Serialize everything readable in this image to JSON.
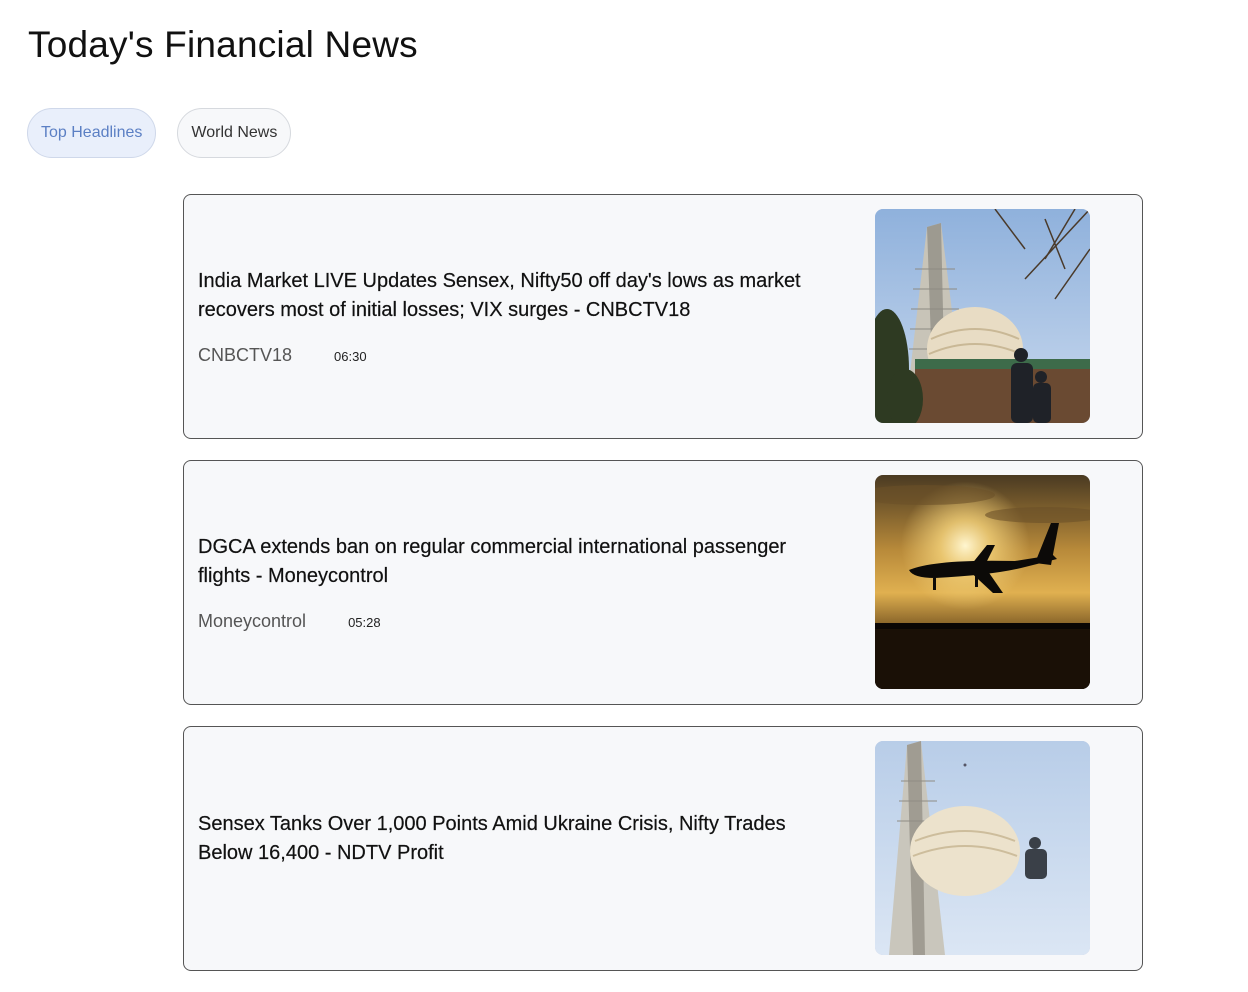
{
  "page": {
    "title": "Today's Financial News"
  },
  "tabs": [
    {
      "label": "Top Headlines",
      "active": true
    },
    {
      "label": "World News",
      "active": false
    }
  ],
  "articles": [
    {
      "headline": "India Market LIVE Updates Sensex, Nifty50 off day's lows as market recovers most of initial losses; VIX surges - CNBCTV18",
      "source": "CNBCTV18",
      "time": "06:30",
      "image": "stock-exchange-building-photo"
    },
    {
      "headline": "DGCA extends ban on regular commercial international passenger flights - Moneycontrol",
      "source": "Moneycontrol",
      "time": "05:28",
      "image": "airplane-sunset-photo"
    },
    {
      "headline": "Sensex Tanks Over 1,000 Points Amid Ukraine Crisis, Nifty Trades Below 16,400 - NDTV Profit",
      "source": "",
      "time": "",
      "image": "stock-exchange-building-photo"
    }
  ],
  "colors": {
    "active_tab_text": "#5b7fc4",
    "active_tab_bg": "#e9effb",
    "card_bg": "#f7f8fa"
  }
}
